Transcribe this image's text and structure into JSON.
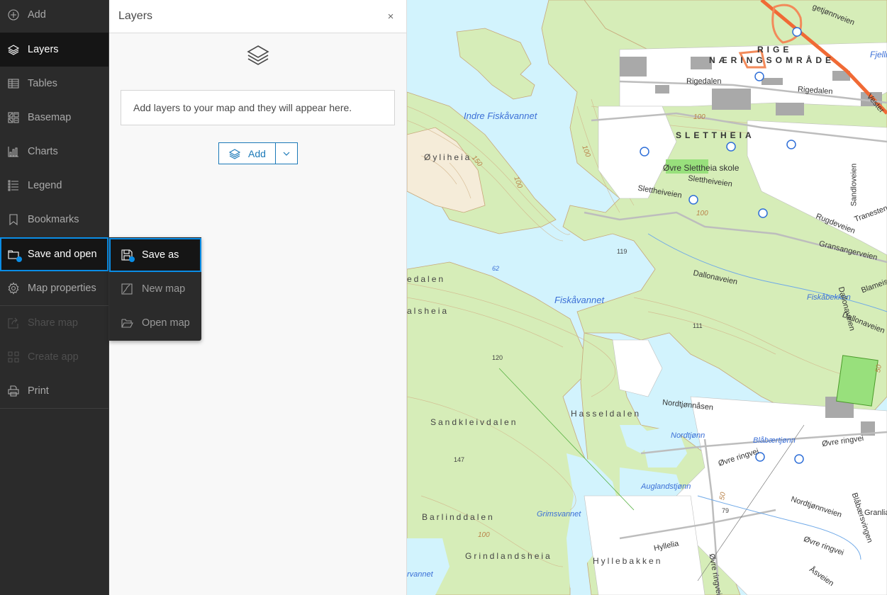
{
  "sidebar": {
    "items": [
      {
        "label": "Add",
        "icon": "add-circle-icon",
        "state": "normal"
      },
      {
        "label": "Layers",
        "icon": "layers-icon",
        "state": "active"
      },
      {
        "label": "Tables",
        "icon": "table-icon",
        "state": "normal"
      },
      {
        "label": "Basemap",
        "icon": "basemap-icon",
        "state": "normal"
      },
      {
        "label": "Charts",
        "icon": "chart-icon",
        "state": "normal"
      },
      {
        "label": "Legend",
        "icon": "legend-icon",
        "state": "normal"
      },
      {
        "label": "Bookmarks",
        "icon": "bookmark-icon",
        "state": "normal"
      },
      {
        "label": "Save and open",
        "icon": "folder-icon",
        "state": "selected"
      },
      {
        "label": "Map properties",
        "icon": "gear-icon",
        "state": "normal"
      },
      {
        "label": "Share map",
        "icon": "share-icon",
        "state": "disabled"
      },
      {
        "label": "Create app",
        "icon": "apps-icon",
        "state": "disabled"
      },
      {
        "label": "Print",
        "icon": "print-icon",
        "state": "normal"
      }
    ]
  },
  "flyout": {
    "items": [
      {
        "label": "Save as",
        "icon": "save-icon",
        "state": "selected"
      },
      {
        "label": "New map",
        "icon": "new-map-icon",
        "state": "normal"
      },
      {
        "label": "Open map",
        "icon": "open-folder-icon",
        "state": "normal"
      }
    ]
  },
  "panel": {
    "title": "Layers",
    "close_label": "×",
    "empty_message": "Add layers to your map and they will appear here.",
    "add_button_label": "Add"
  },
  "colors": {
    "accent": "#0a8de6",
    "button_blue": "#1b79b8",
    "sidebar_bg": "#2b2b2b",
    "sidebar_active_bg": "#151515"
  },
  "map": {
    "water_labels": [
      "Indre Fiskåvannet",
      "Fiskåvannet",
      "Fiskåbekken",
      "Nordtjønn",
      "Blåbærtjønn",
      "Auglandstjønn",
      "Grimsvannet",
      "rvannet",
      "Fjellr"
    ],
    "place_labels": [
      "Øyliheia",
      "edalen",
      "alsheia",
      "Sandkleivdalen",
      "Hasseldalen",
      "Barlinddalen",
      "Grindlandsheia",
      "Hyllebakken"
    ],
    "district_labels": [
      "RIGE",
      "NÆRINGSOMRÅDE",
      "SLETTHEIA"
    ],
    "poi_labels": [
      "Øvre Slettheia skole"
    ],
    "road_labels": [
      "Rigedalen",
      "Rigedalen",
      "Slettheiveien",
      "Slettheiveien",
      "Dallonaveien",
      "Dallonaveien",
      "Dallonaveien",
      "Rugdeveien",
      "Gransangerveien",
      "Tranesten",
      "Sandloveien",
      "Nordtjønnåsen",
      "Øvre ringvei",
      "Øvre ringvei",
      "Øvre ringvei",
      "Øvre ringvei",
      "Nordtjønnveien",
      "Blåbærsvingen",
      "Hyllelia",
      "Åsveien",
      "Vester",
      "Blameis",
      "Granlia",
      "getjønnveien"
    ],
    "elevations": [
      "119",
      "62",
      "111",
      "120",
      "147",
      "79"
    ],
    "contours": [
      "100",
      "100",
      "100",
      "100",
      "100",
      "150",
      "50",
      "50"
    ]
  }
}
